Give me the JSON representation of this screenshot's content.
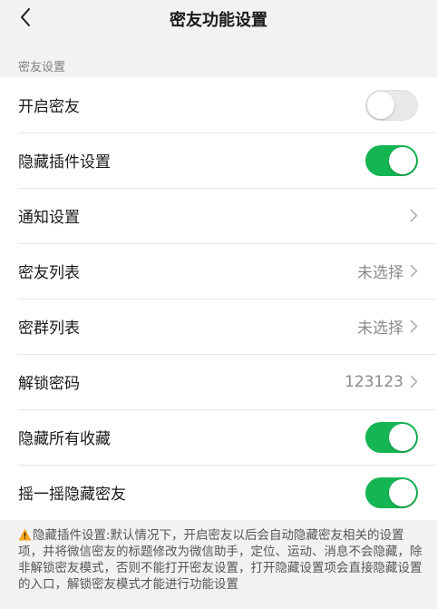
{
  "nav": {
    "title": "密友功能设置"
  },
  "section": {
    "header": "密友设置"
  },
  "rows": [
    {
      "label": "开启密友",
      "type": "toggle",
      "on": false
    },
    {
      "label": "隐藏插件设置",
      "type": "toggle",
      "on": true
    },
    {
      "label": "通知设置",
      "type": "link",
      "value": ""
    },
    {
      "label": "密友列表",
      "type": "link",
      "value": "未选择"
    },
    {
      "label": "密群列表",
      "type": "link",
      "value": "未选择"
    },
    {
      "label": "解锁密码",
      "type": "link",
      "value": "123123"
    },
    {
      "label": "隐藏所有收藏",
      "type": "toggle",
      "on": true
    },
    {
      "label": "摇一摇隐藏密友",
      "type": "toggle",
      "on": true
    }
  ],
  "footer": {
    "note": "隐藏插件设置:默认情况下，开启密友以后会自动隐藏密友相关的设置项，并将微信密友的标题修改为微信助手，定位、运动、消息不会隐藏，除非解锁密友模式，否则不能打开密友设置，打开隐藏设置项会直接隐藏设置的入口，解锁密友模式才能进行功能设置"
  },
  "colors": {
    "toggle_on": "#16b554",
    "toggle_off": "#e8e8e8",
    "warning": "#f5a623"
  },
  "icons": {
    "back": "chevron-left-icon",
    "row_arrow": "chevron-right-icon",
    "footer": "warning-icon"
  }
}
